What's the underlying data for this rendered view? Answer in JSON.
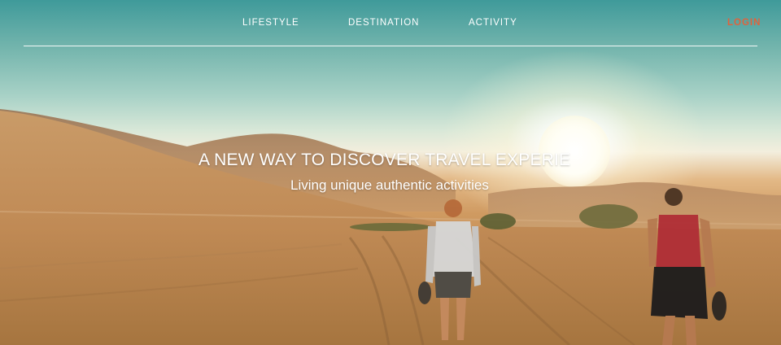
{
  "nav": {
    "items": [
      {
        "label": "LIFESTYLE"
      },
      {
        "label": "DESTINATION"
      },
      {
        "label": "ACTIVITY"
      }
    ],
    "login_label": "LOGIN"
  },
  "hero": {
    "headline": "A NEW WAY TO DISCOVER TRAVEL EXPERIE",
    "subheadline": "Living unique authentic activities"
  },
  "colors": {
    "login_accent": "#e1623c",
    "nav_text": "#ffffff"
  }
}
